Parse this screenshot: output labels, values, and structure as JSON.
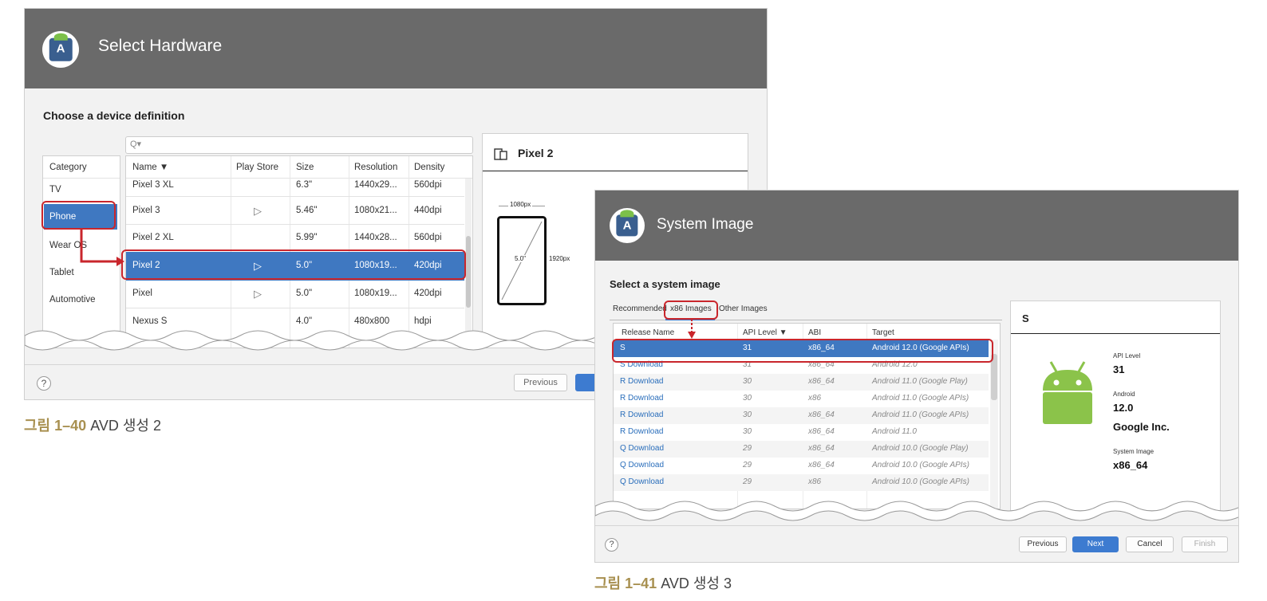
{
  "dialog1": {
    "title": "Select Hardware",
    "subtitle": "Choose a device definition",
    "search_icon": "search-icon",
    "category_header": "Category",
    "categories": [
      "TV",
      "Phone",
      "Wear OS",
      "Tablet",
      "Automotive"
    ],
    "columns": {
      "name": "Name ▼",
      "play_store": "Play Store",
      "size": "Size",
      "resolution": "Resolution",
      "density": "Density"
    },
    "rows": [
      {
        "name": "Pixel 3 XL",
        "play": false,
        "size": "6.3\"",
        "resolution": "1440x29...",
        "density": "560dpi"
      },
      {
        "name": "Pixel 3",
        "play": true,
        "size": "5.46\"",
        "resolution": "1080x21...",
        "density": "440dpi"
      },
      {
        "name": "Pixel 2 XL",
        "play": false,
        "size": "5.99\"",
        "resolution": "1440x28...",
        "density": "560dpi"
      },
      {
        "name": "Pixel 2",
        "play": true,
        "size": "5.0\"",
        "resolution": "1080x19...",
        "density": "420dpi"
      },
      {
        "name": "Pixel",
        "play": true,
        "size": "5.0\"",
        "resolution": "1080x19...",
        "density": "420dpi"
      },
      {
        "name": "Nexus S",
        "play": false,
        "size": "4.0\"",
        "resolution": "480x800",
        "density": "hdpi"
      }
    ],
    "preview": {
      "title": "Pixel 2",
      "width_label": "1080px",
      "height_label": "1920px",
      "diag_label": "5.0\""
    },
    "help": "?",
    "previous": "Previous"
  },
  "caption1": {
    "prefix": "그림 1–",
    "num": "40",
    "text": " AVD 생성 2"
  },
  "dialog2": {
    "title": "System Image",
    "subtitle": "Select a system image",
    "tabs": [
      "Recommended",
      "x86 Images",
      "Other Images"
    ],
    "columns": {
      "release": "Release Name",
      "api": "API Level ▼",
      "abi": "ABI",
      "target": "Target"
    },
    "rows": [
      {
        "release": "S",
        "api": "31",
        "abi": "x86_64",
        "target": "Android 12.0 (Google APIs)",
        "selected": true
      },
      {
        "release": "S Download",
        "api": "31",
        "abi": "x86_64",
        "target": "Android 12.0"
      },
      {
        "release": "R Download",
        "api": "30",
        "abi": "x86_64",
        "target": "Android 11.0 (Google Play)"
      },
      {
        "release": "R Download",
        "api": "30",
        "abi": "x86",
        "target": "Android 11.0 (Google APIs)"
      },
      {
        "release": "R Download",
        "api": "30",
        "abi": "x86_64",
        "target": "Android 11.0 (Google APIs)"
      },
      {
        "release": "R Download",
        "api": "30",
        "abi": "x86_64",
        "target": "Android 11.0"
      },
      {
        "release": "Q Download",
        "api": "29",
        "abi": "x86_64",
        "target": "Android 10.0 (Google Play)"
      },
      {
        "release": "Q Download",
        "api": "29",
        "abi": "x86_64",
        "target": "Android 10.0 (Google APIs)"
      },
      {
        "release": "Q Download",
        "api": "29",
        "abi": "x86",
        "target": "Android 10.0 (Google APIs)"
      }
    ],
    "info": {
      "title": "S",
      "api_label": "API Level",
      "api_value": "31",
      "android_label": "Android",
      "android_value": "12.0",
      "vendor": "Google Inc.",
      "sysimg_label": "System Image",
      "sysimg_value": "x86_64"
    },
    "help": "?",
    "buttons": {
      "previous": "Previous",
      "next": "Next",
      "cancel": "Cancel",
      "finish": "Finish"
    }
  },
  "caption2": {
    "prefix": "그림 1–",
    "num": "41",
    "text": " AVD 생성 3"
  },
  "colors": {
    "header": "#6a6a6a",
    "selection": "#3f78c1",
    "highlight": "#c9262c",
    "link": "#2a6ebb"
  }
}
